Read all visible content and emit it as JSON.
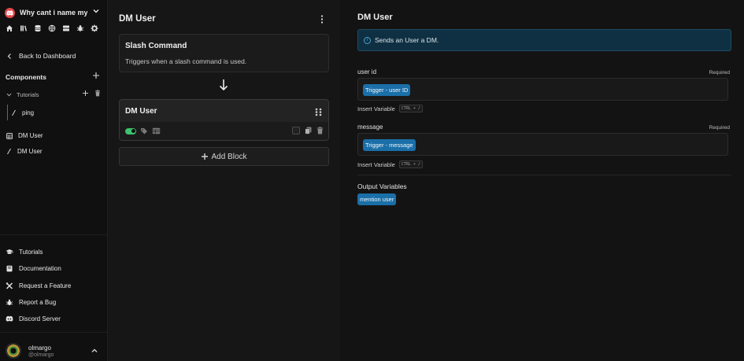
{
  "sidebar": {
    "server_name": "Why cant i name my...",
    "back_label": "Back to Dashboard",
    "components_label": "Components",
    "folder_label": "Tutorials",
    "items": [
      {
        "label": "ping",
        "icon": "slash-icon"
      },
      {
        "label": "DM User",
        "icon": "table-icon"
      },
      {
        "label": "DM User",
        "icon": "slash-icon"
      }
    ],
    "links": [
      {
        "label": "Tutorials",
        "icon": "graduation-cap-icon"
      },
      {
        "label": "Documentation",
        "icon": "book-icon"
      },
      {
        "label": "Request a Feature",
        "icon": "tools-icon"
      },
      {
        "label": "Report a Bug",
        "icon": "bug-icon"
      },
      {
        "label": "Discord Server",
        "icon": "discord-icon"
      }
    ],
    "user": {
      "name": "olmargo",
      "handle": "@olmargo"
    }
  },
  "middle": {
    "title": "DM User",
    "slash_card": {
      "title": "Slash Command",
      "description": "Triggers when a slash command is used."
    },
    "dm_card": {
      "title": "DM User"
    },
    "add_block_label": "Add Block"
  },
  "right": {
    "title": "DM User",
    "info": "Sends an User a DM.",
    "fields": [
      {
        "label": "user id",
        "required": "Required",
        "chip": "Trigger - user ID"
      },
      {
        "label": "message",
        "required": "Required",
        "chip": "Trigger - message"
      }
    ],
    "insert_variable": "Insert Variable",
    "shortcut": "CTRL + /",
    "output_title": "Output Variables",
    "output_chip": "mention user"
  },
  "colors": {
    "accent": "#1a6fa8",
    "toggle_on": "#3ec16d",
    "server_logo": "#e5484d",
    "info_bg": "#0f3043"
  }
}
